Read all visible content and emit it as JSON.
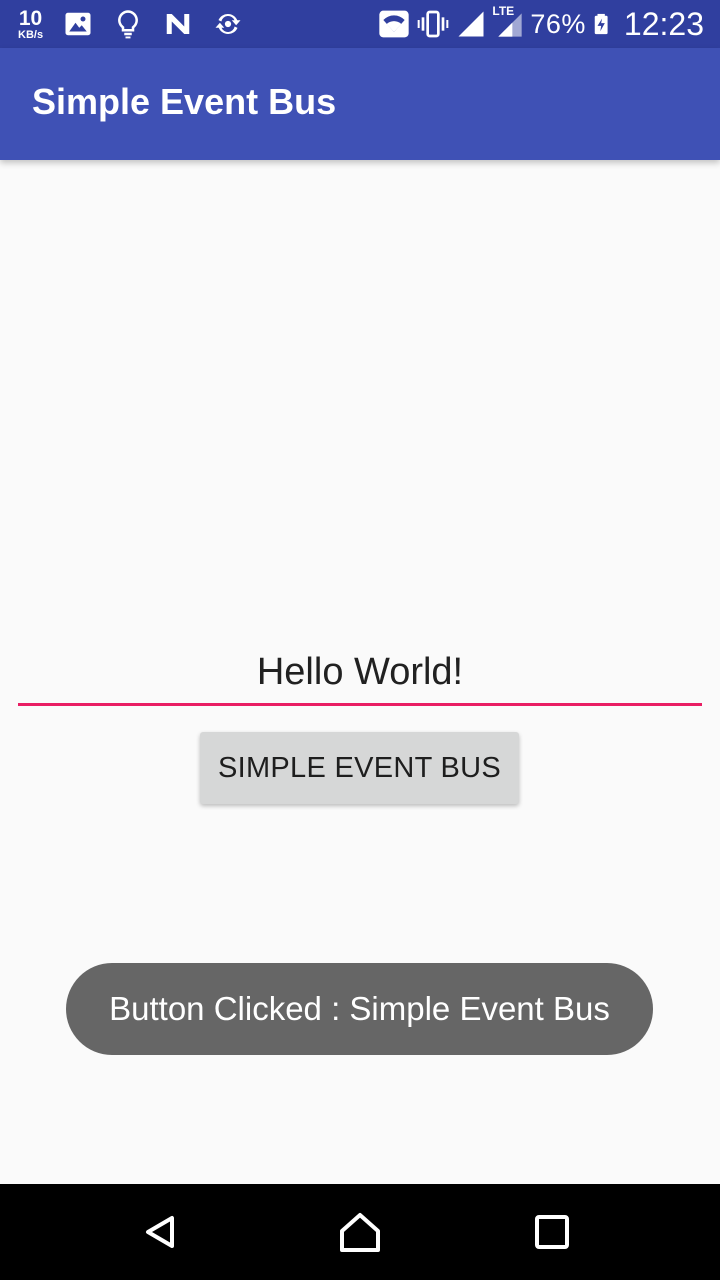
{
  "status_bar": {
    "net_speed_value": "10",
    "net_speed_unit": "KB/s",
    "left_icons": [
      "image-icon",
      "lightbulb-icon",
      "n-notification-icon",
      "sync-icon"
    ],
    "right_icons": [
      "wifi-icon",
      "vibrate-icon",
      "signal-icon",
      "lte-signal-icon",
      "battery-charging-icon"
    ],
    "lte_label": "LTE",
    "battery_percent": "76%",
    "time": "12:23"
  },
  "app_bar": {
    "title": "Simple Event Bus"
  },
  "main": {
    "edit_text_value": "Hello World!",
    "button_label": "SIMPLE EVENT BUS"
  },
  "toast": {
    "message": "Button Clicked : Simple Event Bus"
  },
  "nav_bar": {
    "icons": [
      "back-icon",
      "home-icon",
      "recents-icon"
    ]
  },
  "colors": {
    "status_bar": "#303f9f",
    "app_bar": "#3f51b5",
    "accent": "#e91e63",
    "background": "#fafafa",
    "button": "#d6d7d7",
    "toast": "#666666",
    "nav_bar": "#000000"
  }
}
